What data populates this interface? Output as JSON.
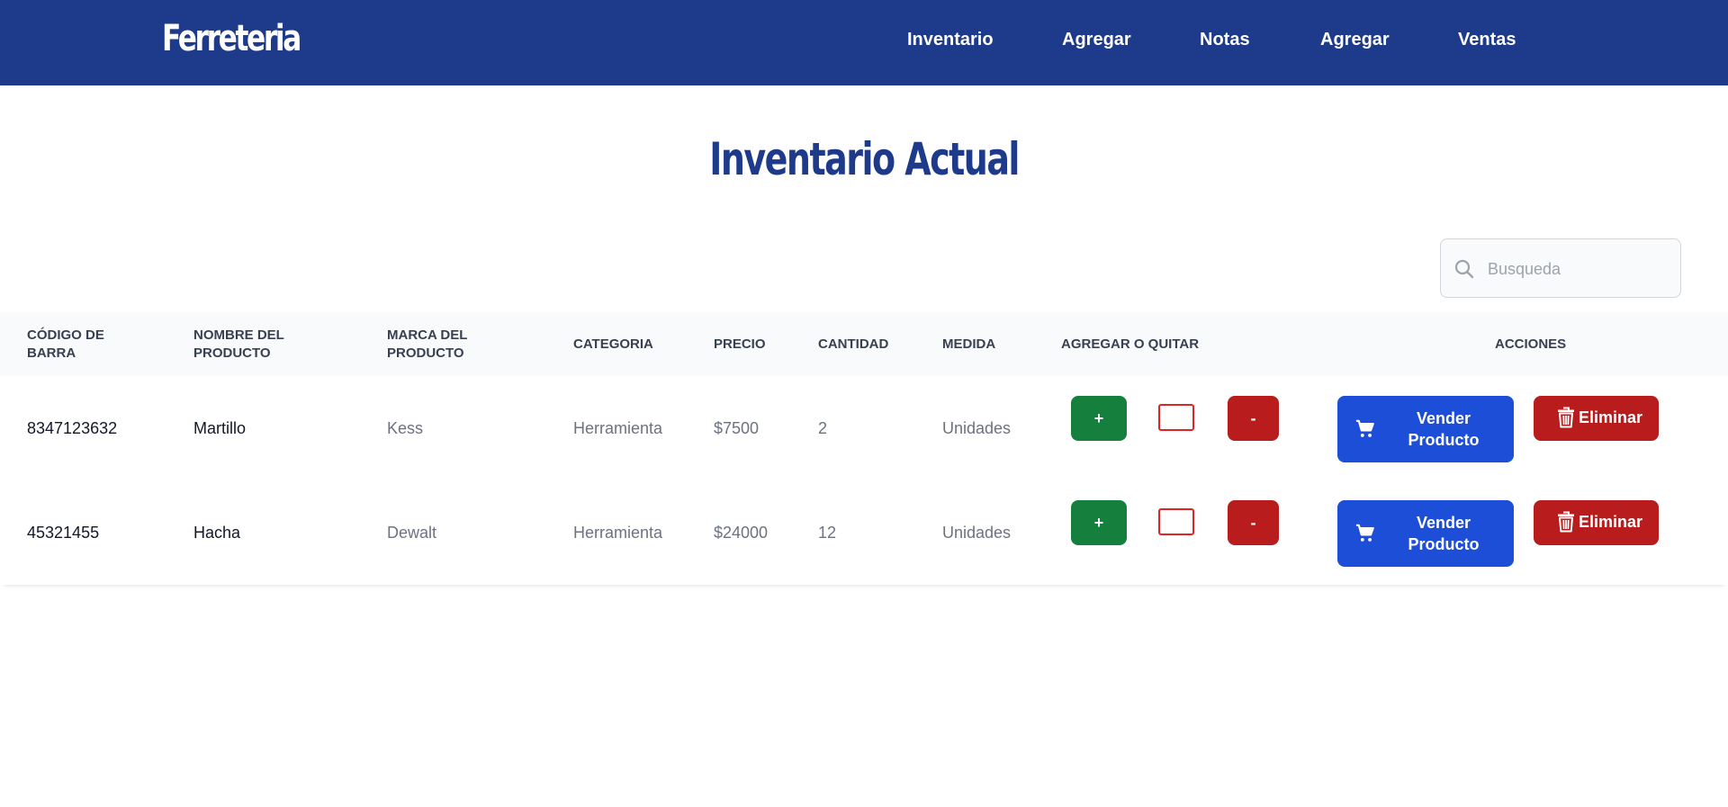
{
  "navbar": {
    "brand": "Ferreteria",
    "links": [
      "Inventario",
      "Agregar",
      "Notas",
      "Agregar",
      "Ventas"
    ],
    "background": "#1e3a8a"
  },
  "page": {
    "title": "Inventario Actual"
  },
  "search": {
    "placeholder": "Busqueda",
    "value": "",
    "icon": "search-icon"
  },
  "table": {
    "headers": {
      "codigo": "CÓDIGO DE BARRA",
      "nombre": "NOMBRE DEL PRODUCTO",
      "marca": "MARCA DEL PRODUCTO",
      "categoria": "CATEGORIA",
      "precio": "PRECIO",
      "cantidad": "CANTIDAD",
      "medida": "MEDIDA",
      "agregar": "AGREGAR O QUITAR",
      "acciones": "ACCIONES"
    },
    "rows": [
      {
        "codigo": "8347123632",
        "nombre": "Martillo",
        "marca": "Kess",
        "categoria": "Herramienta",
        "precio": "$7500",
        "cantidad": "2",
        "medida": "Unidades",
        "plus_label": "+",
        "minus_label": "-",
        "qty_value": "",
        "sell_label": "Vender Producto",
        "delete_label": "Eliminar"
      },
      {
        "codigo": "45321455",
        "nombre": "Hacha",
        "marca": "Dewalt",
        "categoria": "Herramienta",
        "precio": "$24000",
        "cantidad": "12",
        "medida": "Unidades",
        "plus_label": "+",
        "minus_label": "-",
        "qty_value": "",
        "sell_label": "Vender Producto",
        "delete_label": "Eliminar"
      }
    ]
  },
  "colors": {
    "primary": "#1e3a8a",
    "green": "#15803d",
    "red": "#b91c1c",
    "blue": "#1d4ed8"
  }
}
